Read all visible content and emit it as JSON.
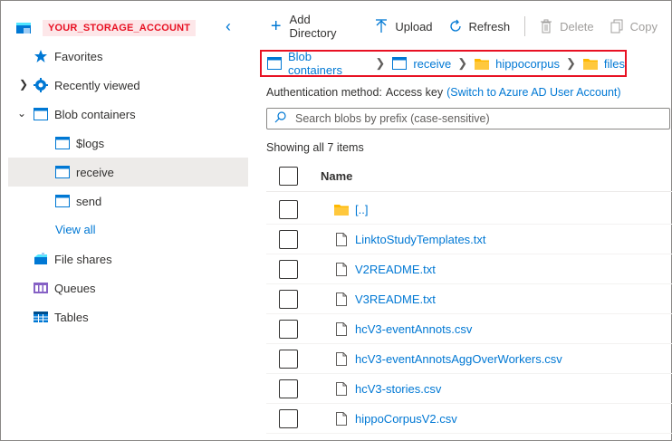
{
  "account": {
    "name": "YOUR_STORAGE_ACCOUNT"
  },
  "sidebar": {
    "collapse_icon": "chevron-left-icon",
    "items": [
      {
        "label": "Favorites",
        "icon": "star-icon"
      },
      {
        "label": "Recently viewed",
        "icon": "gear-icon"
      },
      {
        "label": "Blob containers",
        "icon": "container-icon"
      },
      {
        "label": "$logs",
        "icon": "container-icon"
      },
      {
        "label": "receive",
        "icon": "container-icon"
      },
      {
        "label": "send",
        "icon": "container-icon"
      },
      {
        "label": "View all"
      },
      {
        "label": "File shares",
        "icon": "file-share-icon"
      },
      {
        "label": "Queues",
        "icon": "queue-icon"
      },
      {
        "label": "Tables",
        "icon": "table-icon"
      }
    ],
    "selected": "receive"
  },
  "toolbar": {
    "add_directory": "Add Directory",
    "upload": "Upload",
    "refresh": "Refresh",
    "delete": "Delete",
    "copy": "Copy"
  },
  "breadcrumb": [
    "Blob containers",
    "receive",
    "hippocorpus",
    "files"
  ],
  "auth": {
    "label": "Authentication method:",
    "value": "Access key",
    "switch_link": "(Switch to Azure AD User Account)"
  },
  "search": {
    "placeholder": "Search blobs by prefix (case-sensitive)"
  },
  "count_text": "Showing all 7 items",
  "table": {
    "header": "Name",
    "rows": [
      {
        "name": "[..]",
        "type": "folder"
      },
      {
        "name": "LinktoStudyTemplates.txt",
        "type": "file"
      },
      {
        "name": "V2README.txt",
        "type": "file"
      },
      {
        "name": "V3README.txt",
        "type": "file"
      },
      {
        "name": "hcV3-eventAnnots.csv",
        "type": "file"
      },
      {
        "name": "hcV3-eventAnnotsAggOverWorkers.csv",
        "type": "file"
      },
      {
        "name": "hcV3-stories.csv",
        "type": "file"
      },
      {
        "name": "hippoCorpusV2.csv",
        "type": "file"
      }
    ]
  },
  "colors": {
    "accent": "#0078d4",
    "highlight": "#e81123",
    "selected_bg": "#edebe9",
    "folder": "#ffb900"
  }
}
